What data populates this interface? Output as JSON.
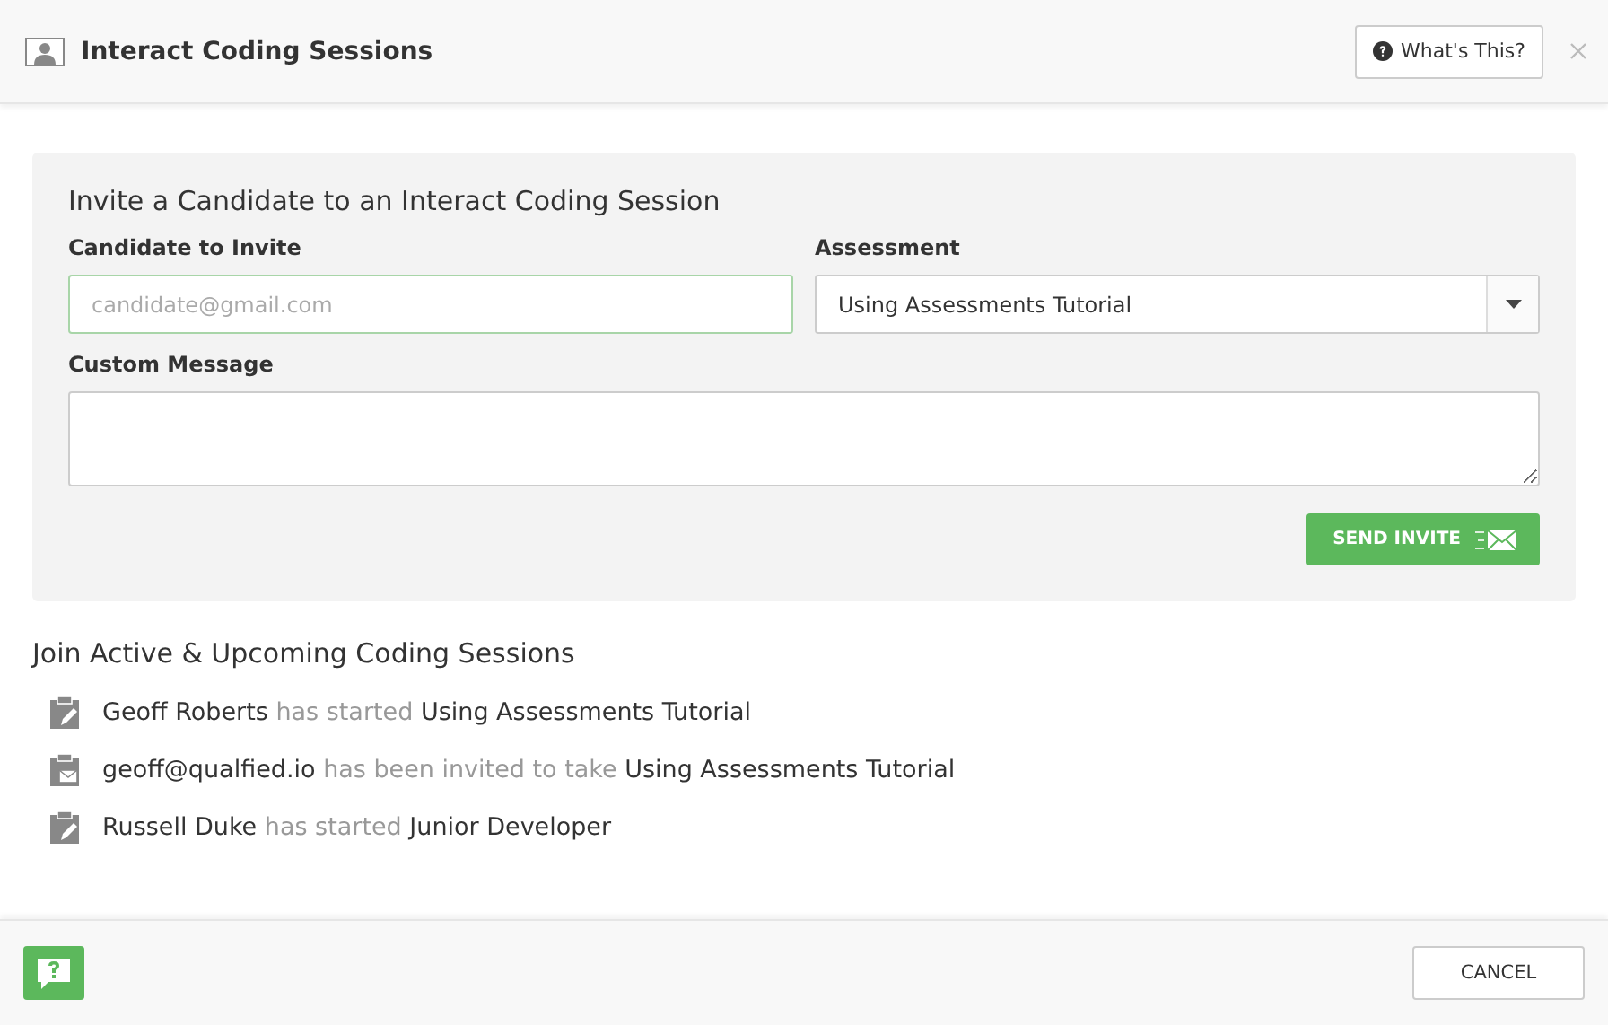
{
  "window": {
    "title": "Interact Coding Sessions"
  },
  "header_buttons": {
    "help": "What's This?"
  },
  "invite": {
    "heading": "Invite a Candidate to an Interact Coding Session",
    "candidate": {
      "label": "Candidate to Invite",
      "placeholder": "candidate@gmail.com"
    },
    "assessment": {
      "label": "Assessment",
      "value": "Using Assessments Tutorial"
    },
    "message": {
      "label": "Custom Message"
    },
    "send_button": "SEND INVITE"
  },
  "sessions": {
    "heading": "Join Active & Upcoming Coding Sessions",
    "items": [
      {
        "kind": "started",
        "who": "Geoff Roberts",
        "action": "has started",
        "target": "Using Assessments Tutorial"
      },
      {
        "kind": "invited",
        "who": "geoff@qualfied.io",
        "action": "has been invited to take",
        "target": "Using Assessments Tutorial"
      },
      {
        "kind": "started",
        "who": "Russell Duke",
        "action": "has started",
        "target": "Junior Developer"
      }
    ]
  },
  "footer": {
    "cancel": "CANCEL"
  }
}
